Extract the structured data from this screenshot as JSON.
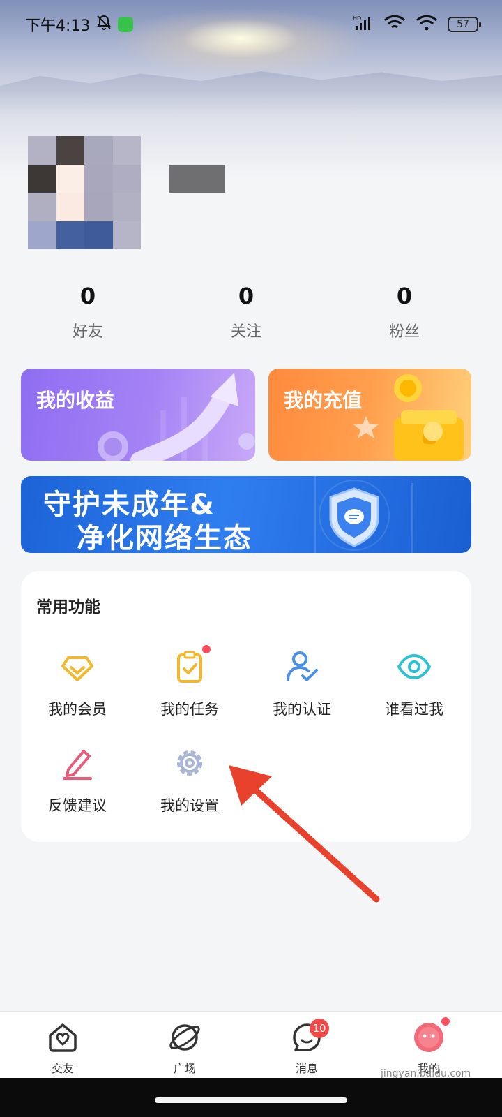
{
  "status_bar": {
    "time": "下午4:13",
    "battery": "57",
    "icons": [
      "bell-off-icon",
      "app-badge-icon",
      "hd-signal-icon",
      "wifi-icon",
      "wifi-icon",
      "battery-icon"
    ]
  },
  "profile": {
    "avatar": "pixelated-avatar"
  },
  "stats": [
    {
      "value": "0",
      "label": "好友"
    },
    {
      "value": "0",
      "label": "关注"
    },
    {
      "value": "0",
      "label": "粉丝"
    }
  ],
  "cards": {
    "income": {
      "title": "我的收益"
    },
    "recharge": {
      "title": "我的充值"
    }
  },
  "banner": {
    "line1": "守护未成年&",
    "line2": "净化网络生态"
  },
  "functions": {
    "title": "常用功能",
    "items": [
      {
        "label": "我的会员",
        "icon": "diamond-icon"
      },
      {
        "label": "我的任务",
        "icon": "clipboard-check-icon"
      },
      {
        "label": "我的认证",
        "icon": "user-check-icon"
      },
      {
        "label": "谁看过我",
        "icon": "eye-icon"
      },
      {
        "label": "反馈建议",
        "icon": "pencil-icon"
      },
      {
        "label": "我的设置",
        "icon": "gear-icon"
      }
    ]
  },
  "bottom_nav": {
    "items": [
      {
        "label": "交友",
        "icon": "home-heart-icon"
      },
      {
        "label": "广场",
        "icon": "planet-icon"
      },
      {
        "label": "消息",
        "icon": "chat-face-icon",
        "badge": "10"
      },
      {
        "label": "我的",
        "icon": "avatar-icon"
      }
    ]
  },
  "watermark": "jingyan.baidu.com",
  "colors": {
    "page_bg": "#f4f5f7",
    "income_card": "#8f6df2",
    "recharge_card": "#ff8a3d",
    "banner": "#1c63d6",
    "badge_red": "#f24848",
    "annotation_arrow": "#e8412c"
  }
}
